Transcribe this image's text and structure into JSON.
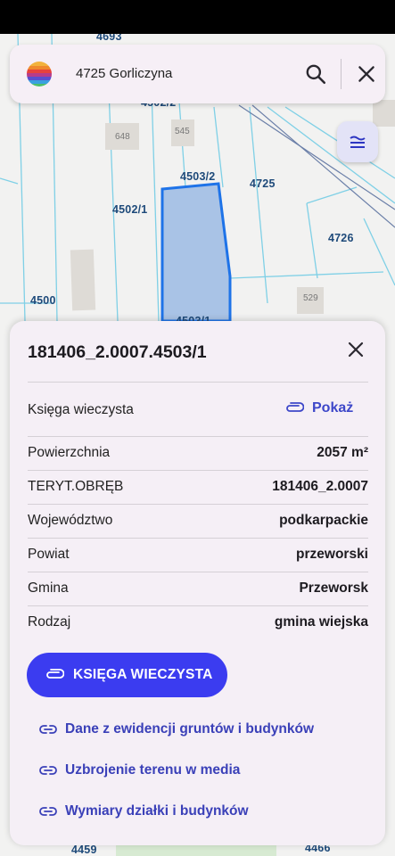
{
  "search": {
    "query": "4725 Gorliczyna"
  },
  "map": {
    "parcels": [
      "4693",
      "4502/2",
      "648",
      "545",
      "4503/2",
      "4725",
      "4502/1",
      "4726",
      "4500",
      "529",
      "4503/1",
      "4459",
      "4466"
    ]
  },
  "sheet": {
    "title": "181406_2.0007.4503/1",
    "kw_label": "Księga wieczysta",
    "kw_link": "Pokaż",
    "rows": [
      {
        "label": "Powierzchnia",
        "value": "2057 m²"
      },
      {
        "label": "TERYT.OBRĘB",
        "value": "181406_2.0007"
      },
      {
        "label": "Województwo",
        "value": "podkarpackie"
      },
      {
        "label": "Powiat",
        "value": "przeworski"
      },
      {
        "label": "Gmina",
        "value": "Przeworsk"
      },
      {
        "label": "Rodzaj",
        "value": "gmina wiejska"
      }
    ],
    "primary_button": "KSIĘGA WIECZYSTA",
    "links": [
      "Dane z ewidencji gruntów i budynków",
      "Uzbrojenie terenu w media",
      "Wymiary działki i budynków"
    ]
  },
  "colors": {
    "accent": "#3b3cf0",
    "link": "#3a40b8",
    "parcel_fill": "#a9c3e6",
    "parcel_stroke": "#1e73e8"
  },
  "icons": {
    "logo": "rainbow-logo",
    "search": "search-icon",
    "close": "close-icon",
    "layers": "layers-icon",
    "attachment": "paperclip-icon",
    "link": "link-icon"
  }
}
